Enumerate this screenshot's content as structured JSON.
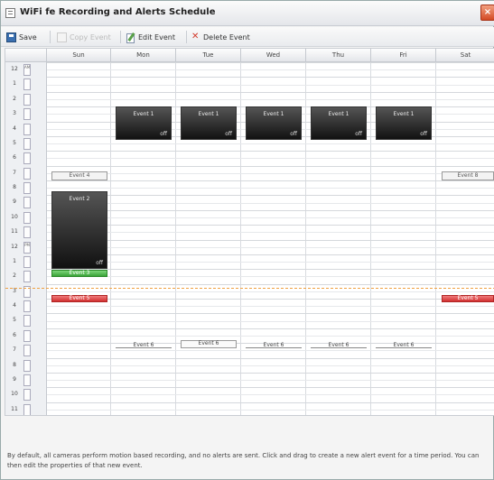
{
  "window": {
    "title": "WiFi fe Recording and Alerts Schedule",
    "close_label": "×"
  },
  "toolbar": {
    "save": "Save",
    "copy_event": "Copy Event",
    "edit_event": "Edit Event",
    "delete_event": "Delete Event"
  },
  "days": [
    "Sun",
    "Mon",
    "Tue",
    "Wed",
    "Thu",
    "Fri",
    "Sat"
  ],
  "hours": [
    "12",
    "1",
    "2",
    "3",
    "4",
    "5",
    "6",
    "7",
    "8",
    "9",
    "10",
    "11",
    "12",
    "1",
    "2",
    "3",
    "4",
    "5",
    "6",
    "7",
    "8",
    "9",
    "10",
    "11"
  ],
  "ampm": [
    "AM",
    "",
    "",
    "",
    "",
    "",
    "",
    "",
    "",
    "",
    "",
    "",
    "PM",
    "",
    "",
    "",
    "",
    "",
    "",
    "",
    "",
    "",
    "",
    ""
  ],
  "events": {
    "weekday_dark": [
      {
        "day": "Mon",
        "title": "Event 1",
        "state": "off"
      },
      {
        "day": "Tue",
        "title": "Event 1",
        "state": "off"
      },
      {
        "day": "Wed",
        "title": "Event 1",
        "state": "off"
      },
      {
        "day": "Thu",
        "title": "Event 1",
        "state": "off"
      },
      {
        "day": "Fri",
        "title": "Event 1",
        "state": "off"
      }
    ],
    "sun_morning_light": "Event 4",
    "sun_dark": {
      "title": "Event 2",
      "state": "off"
    },
    "sun_green": "Event 3",
    "sun_red": "Event 5",
    "sat_light": "Event 8",
    "sat_red": "Event 5",
    "evening": [
      "Event 6",
      "Event 6",
      "Event 6",
      "Event 6",
      "Event 6"
    ]
  },
  "footer": {
    "text": "By default, all cameras perform motion based recording, and no alerts are sent. Click and drag to create a new alert event for a time period. You can then edit the properties of that new event."
  },
  "colors": {
    "dark_event": "#222222",
    "green_event": "#3aa338",
    "red_event": "#d23030",
    "now_line": "#f0a040"
  }
}
